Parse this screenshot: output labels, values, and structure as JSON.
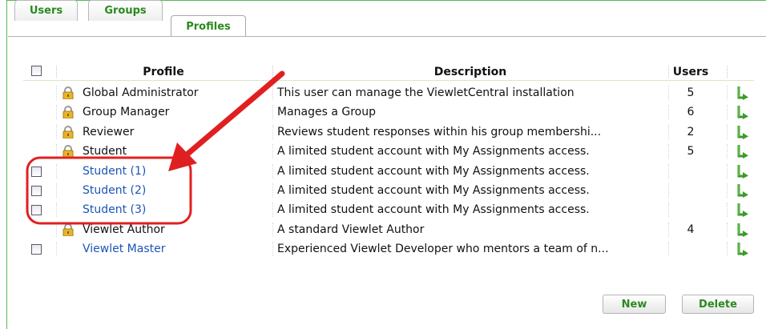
{
  "tabs": [
    {
      "label": "Users"
    },
    {
      "label": "Groups"
    },
    {
      "label": "Profiles"
    }
  ],
  "table": {
    "columns": {
      "profile": "Profile",
      "description": "Description",
      "users": "Users"
    },
    "rows": [
      {
        "profile": "Global Administrator",
        "description": "This user can manage the ViewletCentral installation",
        "users": "5",
        "locked": true,
        "selectable": false
      },
      {
        "profile": "Group Manager",
        "description": "Manages a Group",
        "users": "6",
        "locked": true,
        "selectable": false
      },
      {
        "profile": "Reviewer",
        "description": "Reviews student responses within his group membershi...",
        "users": "2",
        "locked": true,
        "selectable": false
      },
      {
        "profile": "Student",
        "description": "A limited student account with My Assignments access.",
        "users": "5",
        "locked": true,
        "selectable": false
      },
      {
        "profile": "Student (1)",
        "description": "A limited student account with My Assignments access.",
        "users": "",
        "locked": false,
        "selectable": true
      },
      {
        "profile": "Student (2)",
        "description": "A limited student account with My Assignments access.",
        "users": "",
        "locked": false,
        "selectable": true
      },
      {
        "profile": "Student (3)",
        "description": "A limited student account with My Assignments access.",
        "users": "",
        "locked": false,
        "selectable": true
      },
      {
        "profile": "Viewlet Author",
        "description": "A standard Viewlet Author",
        "users": "4",
        "locked": true,
        "selectable": false
      },
      {
        "profile": "Viewlet Master",
        "description": "Experienced Viewlet Developer who mentors a team of n...",
        "users": "",
        "locked": false,
        "selectable": true
      }
    ]
  },
  "buttons": {
    "new": "New",
    "delete": "Delete"
  },
  "colors": {
    "accent_green": "#2a8a1e",
    "link_blue": "#1a56b5",
    "annotation_red": "#e02020"
  },
  "icons": {
    "lock": "lock-icon",
    "action": "green-arrow-icon"
  }
}
